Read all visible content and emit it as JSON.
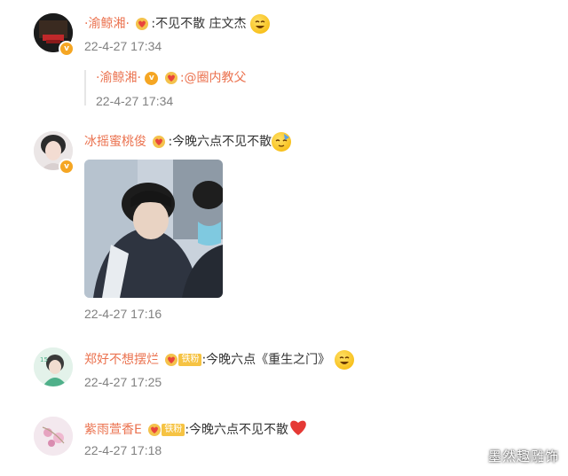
{
  "comments": [
    {
      "username": "·渝鲸湘·",
      "text": ":不见不散  庄文杰",
      "time": "22-4-27 17:34",
      "reply": {
        "username": "·渝鲸湘·",
        "text": ":@圈内教父",
        "time": "22-4-27 17:34"
      }
    },
    {
      "username": "冰摇蜜桃俊",
      "text": ":今晚六点不见不散",
      "time": "22-4-27 17:16"
    },
    {
      "username": "郑好不想摆烂",
      "fan_badge": "铁粉",
      "text": ":今晚六点《重生之门》",
      "time": "22-4-27 17:25"
    },
    {
      "username": "紫雨萱香E",
      "fan_badge": "铁粉",
      "text": ":今晚六点不见不散",
      "time": "22-4-27 17:18"
    }
  ],
  "watermark": "墨然趣雕饰",
  "colors": {
    "username": "#eb7350",
    "text": "#333333",
    "time": "#808080",
    "verified_badge": "#f5a623",
    "fan_badge": "#f6c343"
  }
}
